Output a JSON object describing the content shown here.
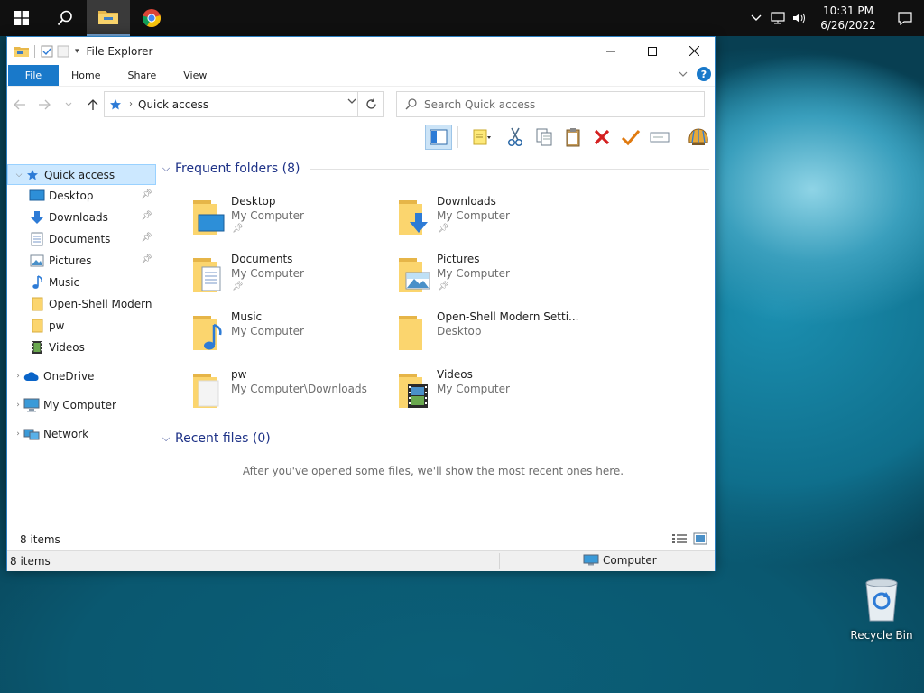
{
  "taskbar": {
    "clock_time": "10:31 PM",
    "clock_date": "6/26/2022",
    "apps": [
      "start-icon",
      "search-icon",
      "file-explorer-icon",
      "chrome-icon"
    ]
  },
  "window": {
    "title": "File Explorer",
    "tabs": [
      {
        "label": "File"
      },
      {
        "label": "Home"
      },
      {
        "label": "Share"
      },
      {
        "label": "View"
      }
    ],
    "help_label": "?",
    "address": {
      "path": "Quick access"
    },
    "search": {
      "placeholder": "Search Quick access"
    }
  },
  "navpane": {
    "quick_access": "Quick access",
    "items": [
      {
        "label": "Desktop",
        "pinned": true
      },
      {
        "label": "Downloads",
        "pinned": true
      },
      {
        "label": "Documents",
        "pinned": true
      },
      {
        "label": "Pictures",
        "pinned": true
      },
      {
        "label": "Music",
        "pinned": false
      },
      {
        "label": "Open-Shell Modern",
        "pinned": false
      },
      {
        "label": "pw",
        "pinned": false
      },
      {
        "label": "Videos",
        "pinned": false
      }
    ],
    "onedrive": "OneDrive",
    "my_computer": "My Computer",
    "network": "Network"
  },
  "content": {
    "frequent_title": "Frequent folders (8)",
    "folders": [
      {
        "name": "Desktop",
        "location": "My Computer"
      },
      {
        "name": "Downloads",
        "location": "My Computer"
      },
      {
        "name": "Documents",
        "location": "My Computer"
      },
      {
        "name": "Pictures",
        "location": "My Computer"
      },
      {
        "name": "Music",
        "location": "My Computer"
      },
      {
        "name": "Open-Shell Modern Setti...",
        "location": "Desktop"
      },
      {
        "name": "pw",
        "location": "My Computer\\Downloads"
      },
      {
        "name": "Videos",
        "location": "My Computer"
      }
    ],
    "recent_title": "Recent files (0)",
    "recent_empty": "After you've opened some files, we'll show the most recent ones here."
  },
  "status": {
    "item_count": "8 items",
    "item_count_bottom": "8 items",
    "zone": "Computer"
  },
  "desktop": {
    "recycle_bin": "Recycle Bin"
  },
  "colors": {
    "accent": "#1979ca",
    "taskbar": "#101010",
    "selection": "#cce8ff",
    "group_title": "#1e3287"
  }
}
